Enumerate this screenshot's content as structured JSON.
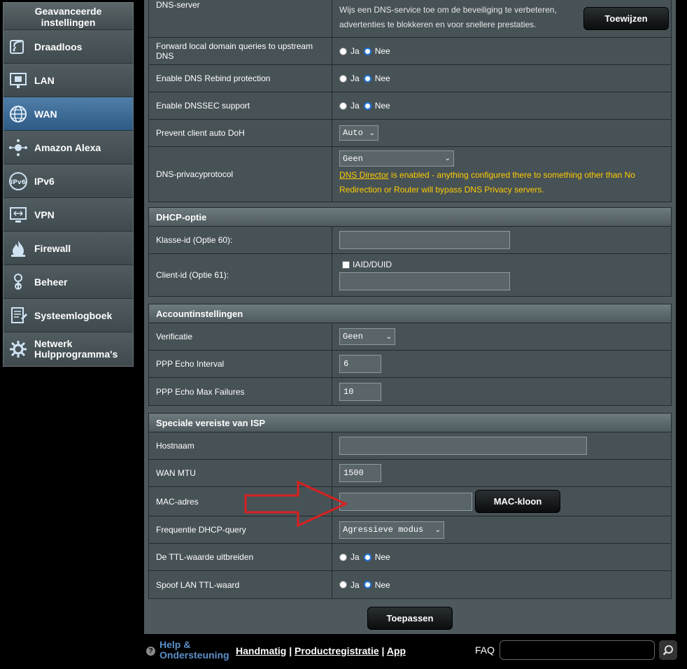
{
  "sidebar": {
    "header": "Geavanceerde instellingen",
    "items": [
      {
        "label": "Draadloos",
        "icon": "wireless-icon"
      },
      {
        "label": "LAN",
        "icon": "lan-icon"
      },
      {
        "label": "WAN",
        "icon": "globe-icon"
      },
      {
        "label": "Amazon Alexa",
        "icon": "alexa-icon"
      },
      {
        "label": "IPv6",
        "icon": "ipv6-icon"
      },
      {
        "label": "VPN",
        "icon": "vpn-icon"
      },
      {
        "label": "Firewall",
        "icon": "fire-icon"
      },
      {
        "label": "Beheer",
        "icon": "admin-icon"
      },
      {
        "label": "Systeemlogboek",
        "icon": "log-icon"
      },
      {
        "label": "Netwerk",
        "label2": "Hulpprogramma's",
        "icon": "tools-icon"
      }
    ],
    "active_index": 2
  },
  "dns": {
    "server_label": "DNS-server",
    "server_desc1": "Wijs een DNS-service toe om de beveiliging te verbeteren,",
    "server_desc2": "advertenties te blokkeren en voor snellere prestaties.",
    "assign_button": "Toewijzen",
    "forward_label": "Forward local domain queries to upstream DNS",
    "rebind_label": "Enable DNS Rebind protection",
    "dnssec_label": "Enable DNSSEC support",
    "doh_label": "Prevent client auto DoH",
    "doh_value": "Auto",
    "privacy_label": "DNS-privacyprotocol",
    "privacy_value": "Geen",
    "privacy_warn_link": "DNS Director",
    "privacy_warn_rest": " is enabled - anything configured there to something other than No Redirection or Router will bypass DNS Privacy servers."
  },
  "radio": {
    "yes": "Ja",
    "no": "Nee"
  },
  "dhcp": {
    "title": "DHCP-optie",
    "class_label": "Klasse-id (Optie 60):",
    "client_label": "Client-id (Optie 61):",
    "iaid_label": "IAID/DUID"
  },
  "account": {
    "title": "Accountinstellingen",
    "auth_label": "Verificatie",
    "auth_value": "Geen",
    "echo_interval_label": "PPP Echo Interval",
    "echo_interval_value": "6",
    "echo_fail_label": "PPP Echo Max Failures",
    "echo_fail_value": "10"
  },
  "isp": {
    "title": "Speciale vereiste van ISP",
    "hostname_label": "Hostnaam",
    "mtu_label": "WAN MTU",
    "mtu_value": "1500",
    "mac_label": "MAC-adres",
    "mac_button": "MAC-kloon",
    "dhcp_freq_label": "Frequentie DHCP-query",
    "dhcp_freq_value": "Agressieve modus",
    "ttl_label": "De TTL-waarde uitbreiden",
    "spoof_label": "Spoof LAN TTL-waard"
  },
  "apply_button": "Toepassen",
  "footer": {
    "help1": "Help &",
    "help2": "Ondersteuning",
    "link_manual": "Handmatig",
    "link_reg": "Productregistratie",
    "link_app": "App",
    "sep": "|",
    "faq": "FAQ"
  },
  "colors": {
    "accent": "#1e75e0",
    "warning": "#ffcc00",
    "arrow": "#d92020"
  }
}
